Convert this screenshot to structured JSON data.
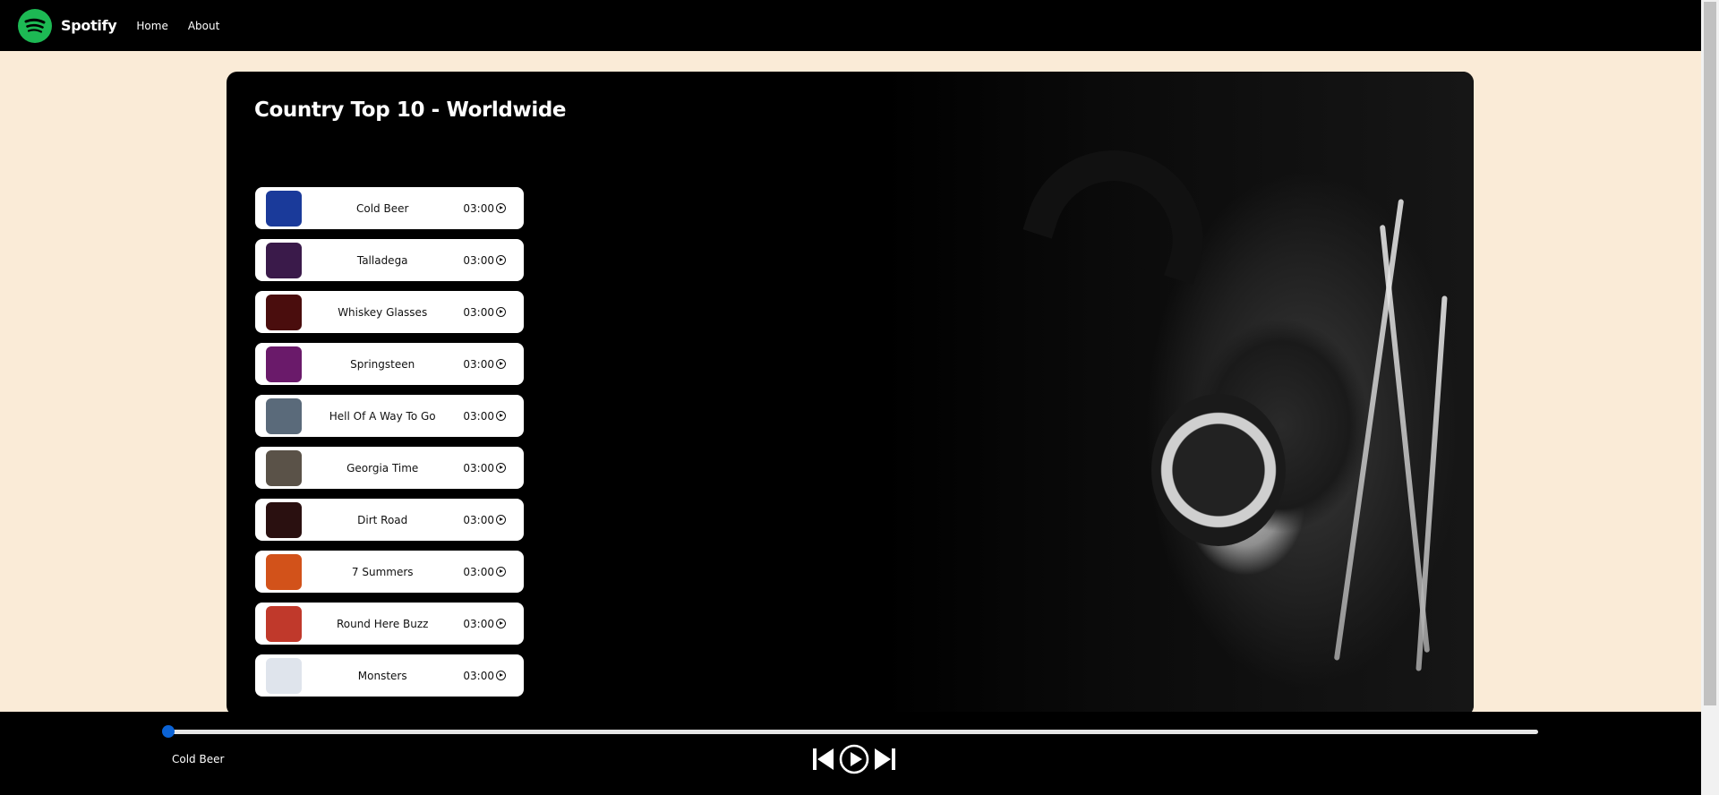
{
  "navbar": {
    "brand": "Spotify",
    "links": [
      "Home",
      "About"
    ],
    "logo_color": "#1db954"
  },
  "card": {
    "title": "Country Top 10 - Worldwide"
  },
  "tracks": [
    {
      "name": "Cold Beer",
      "duration": "03:00",
      "thumb_color": "#1a3a9a"
    },
    {
      "name": "Talladega",
      "duration": "03:00",
      "thumb_color": "#3a1a4a"
    },
    {
      "name": "Whiskey Glasses",
      "duration": "03:00",
      "thumb_color": "#4a0d0d"
    },
    {
      "name": "Springsteen",
      "duration": "03:00",
      "thumb_color": "#6a1a6a"
    },
    {
      "name": "Hell Of A Way To Go",
      "duration": "03:00",
      "thumb_color": "#5a6a7a"
    },
    {
      "name": "Georgia Time",
      "duration": "03:00",
      "thumb_color": "#5a5248"
    },
    {
      "name": "Dirt Road",
      "duration": "03:00",
      "thumb_color": "#2a1010"
    },
    {
      "name": "7 Summers",
      "duration": "03:00",
      "thumb_color": "#d2521a"
    },
    {
      "name": "Round Here Buzz",
      "duration": "03:00",
      "thumb_color": "#c0392b"
    },
    {
      "name": "Monsters",
      "duration": "03:00",
      "thumb_color": "#dfe4ec"
    }
  ],
  "player": {
    "now_playing": "Cold Beer",
    "progress": 0,
    "accent": "#0b63d6"
  }
}
